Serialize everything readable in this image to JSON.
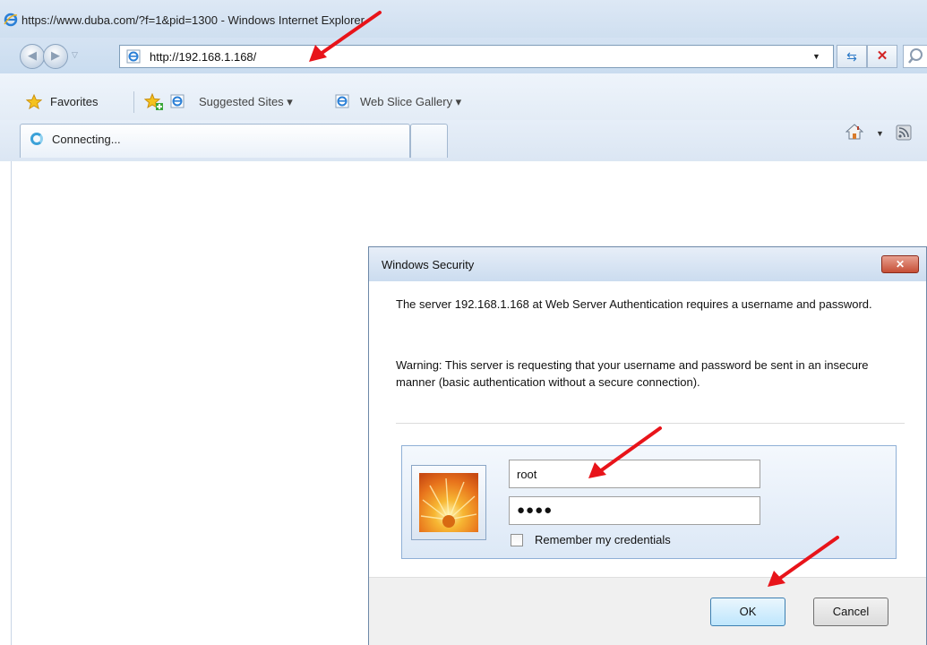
{
  "window": {
    "title": "https://www.duba.com/?f=1&pid=1300 - Windows Internet Explorer"
  },
  "address_bar": {
    "url": "http://192.168.1.168/"
  },
  "favorites_bar": {
    "favorites_label": "Favorites",
    "suggested_sites_label": "Suggested Sites ▾",
    "web_slice_gallery_label": "Web Slice Gallery ▾"
  },
  "tabs": [
    {
      "label": "Connecting..."
    }
  ],
  "dialog": {
    "title": "Windows Security",
    "close_label": "✕",
    "message_line1": "The server 192.168.1.168 at Web Server Authentication requires a username and password.",
    "warning": "Warning: This server is requesting that your username and password be sent in an insecure manner (basic authentication without a secure connection).",
    "username_value": "root",
    "password_mask": "●●●●",
    "remember_label": "Remember my credentials",
    "remember_checked": false,
    "ok_label": "OK",
    "cancel_label": "Cancel"
  },
  "colors": {
    "annotation_arrow": "#e8141a",
    "chrome_blue": "#cfdff0",
    "dialog_close_red": "#c64f36"
  },
  "icons": [
    "ie-icon",
    "back-icon",
    "forward-icon",
    "page-icon",
    "refresh-icon",
    "stop-icon",
    "search-icon",
    "favorites-star-icon",
    "add-favorite-icon",
    "home-icon",
    "feed-icon",
    "loading-spinner-icon",
    "user-tile-icon"
  ]
}
